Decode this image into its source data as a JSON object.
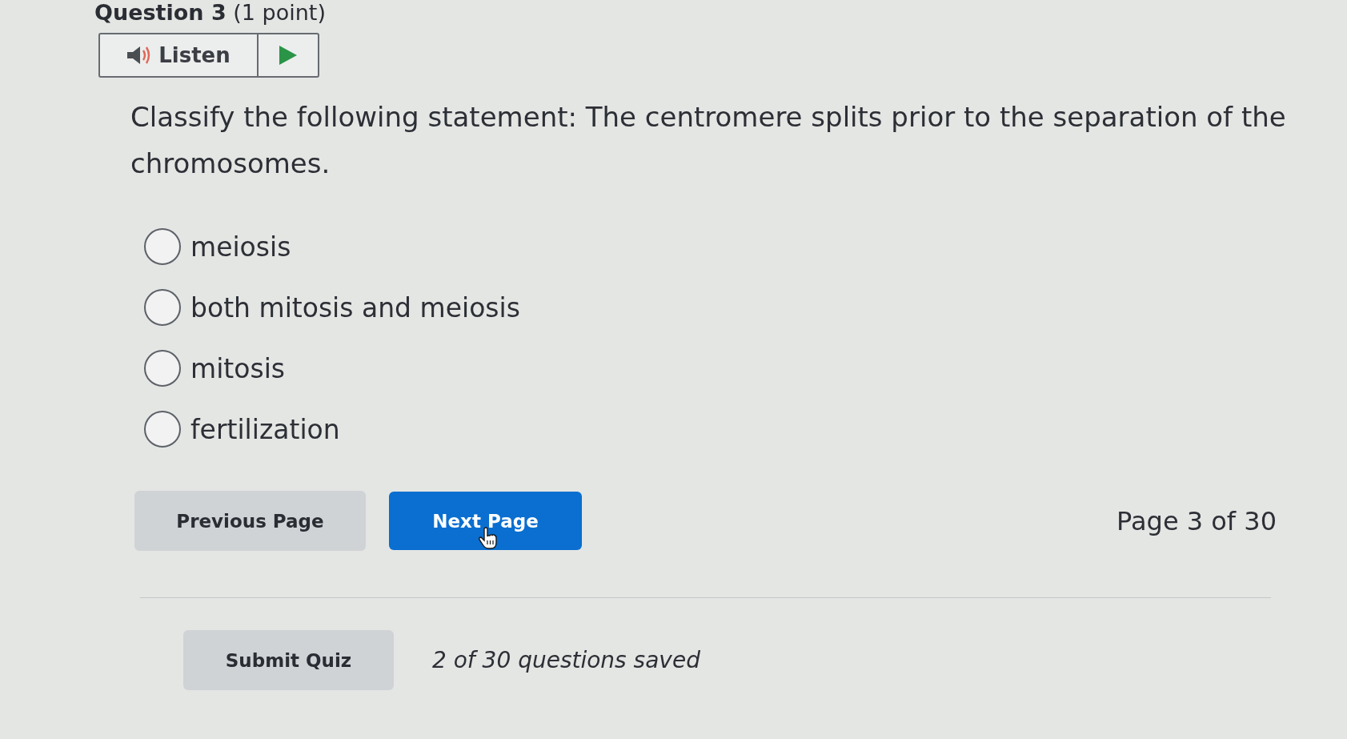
{
  "heading": "**Question 3** (1 point)",
  "listen": {
    "label": "Listen"
  },
  "question": "Classify the following statement: The centromere splits prior to the separation of the chromosomes.",
  "options": [
    {
      "label": "meiosis",
      "selected": false
    },
    {
      "label": "both mitosis and meiosis",
      "selected": false
    },
    {
      "label": "mitosis",
      "selected": false
    },
    {
      "label": "fertilization",
      "selected": false
    }
  ],
  "navigation": {
    "previous": "Previous Page",
    "next": "Next Page",
    "page": "Page 3 of 30"
  },
  "footer": {
    "submit": "Submit Quiz",
    "saved": "2 of 30 questions saved"
  }
}
